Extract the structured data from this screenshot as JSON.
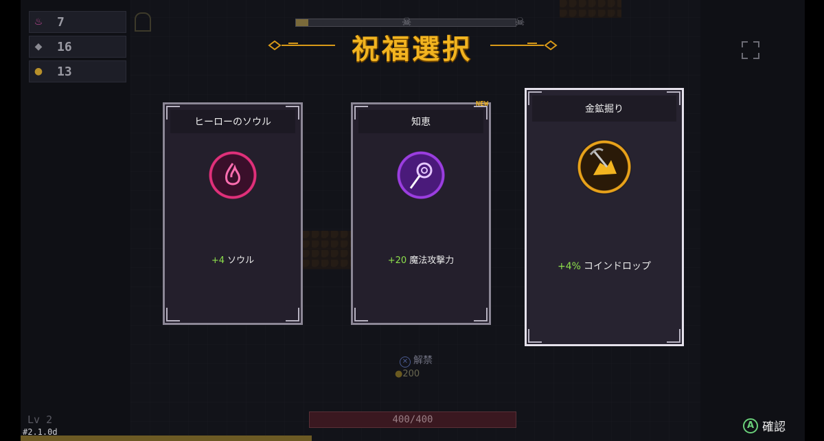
{
  "resources": [
    {
      "icon": "soul-flame-icon",
      "value": "7",
      "color": "#c84a9a"
    },
    {
      "icon": "crystal-icon",
      "value": "16",
      "color": "#8a8a92"
    },
    {
      "icon": "coin-icon",
      "value": "13",
      "color": "#b8902a"
    }
  ],
  "title": "祝福選択",
  "new_badge": "NEW",
  "cards": [
    {
      "name": "ヒーローのソウル",
      "bonus": "+4",
      "stat": "ソウル",
      "icon": "soul-flame-icon",
      "accent": "#e0307a",
      "selected": false
    },
    {
      "name": "知恵",
      "bonus": "+20",
      "stat": "魔法攻撃力",
      "icon": "magic-staff-icon",
      "accent": "#9b3ee0",
      "selected": false
    },
    {
      "name": "金鉱掘り",
      "bonus": "+4%",
      "stat": "コインドロップ",
      "icon": "gold-pickaxe-icon",
      "accent": "#e8a21a",
      "selected": true
    }
  ],
  "unlock_label": "解禁",
  "unlock_cost": "200",
  "hp_text": "400/400",
  "level_text": "Lv 2",
  "version": "#2.1.0d",
  "confirm_button": "A",
  "confirm_label": "確認",
  "colors": {
    "accent_gold": "#f2b420",
    "bonus_green": "#8ee04c"
  }
}
